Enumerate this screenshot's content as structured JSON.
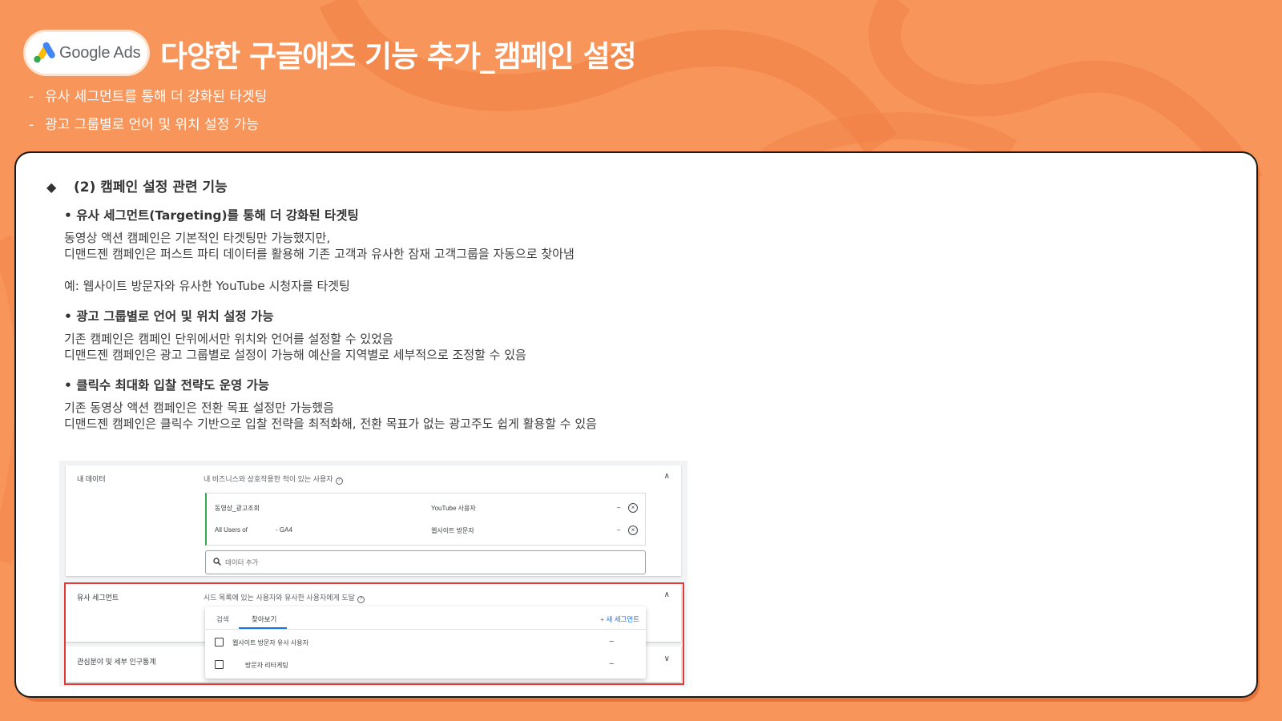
{
  "header": {
    "logo_text": "Google Ads",
    "title": "다양한 구글애즈 기능 추가_캠페인 설정",
    "bullets": [
      "유사 세그먼트를 통해 더 강화된 타겟팅",
      "광고 그룹별로 언어 및 위치 설정 가능"
    ]
  },
  "section": {
    "heading": "(2) 캠페인 설정 관련 기능",
    "features": [
      {
        "title": "• 유사 세그먼트(Targeting)를 통해 더 강화된 타겟팅",
        "lines": [
          "동영상 액션 캠페인은 기본적인 타겟팅만 가능했지만,",
          "디맨드젠 캠페인은 퍼스트 파티 데이터를 활용해 기존 고객과 유사한 잠재 고객그룹을 자동으로 찾아냄"
        ],
        "example": "예: 웹사이트 방문자와 유사한 YouTube 시청자를 타겟팅"
      },
      {
        "title": "• 광고 그룹별로 언어 및 위치 설정 가능",
        "lines": [
          "기존 캠페인은 캠페인 단위에서만 위치와 언어를 설정할 수 있었음",
          "디맨드젠 캠페인은 광고 그룹별로 설정이 가능해 예산을 지역별로 세부적으로 조정할 수 있음"
        ]
      },
      {
        "title": "• 클릭수 최대화 입찰 전략도 운영 가능",
        "lines": [
          "기존 동영상 액션 캠페인은 전환 목표 설정만 가능했음",
          "디맨드젠 캠페인은 클릭수 기반으로 입찰 전략을 최적화해, 전환 목표가 없는 광고주도 쉽게 활용할 수 있음"
        ]
      }
    ]
  },
  "ads_ui": {
    "my_data": {
      "label": "내 데이터",
      "description": "내 비즈니스와 상호작용한 적이 있는 사용자",
      "help_icon": "?",
      "collapse_icon": "∧",
      "rows": [
        {
          "name": "동영상_광고조회",
          "suffix": "",
          "type": "YouTube 사용자",
          "dash": "–",
          "remove": "×"
        },
        {
          "name": "All Users of",
          "suffix": "- GA4",
          "type": "웹사이트 방문자",
          "dash": "–",
          "remove": "×"
        }
      ],
      "search_placeholder": "데이터 추가"
    },
    "similar_segments": {
      "label": "유사 세그먼트",
      "description": "시드 목록에 있는 사용자와 유사한 사용자에게 도달",
      "help_icon": "?",
      "collapse_icon": "∧",
      "tabs": [
        "검색",
        "찾아보기"
      ],
      "new_segment": "+ 새 세그먼트",
      "items": [
        {
          "label": "웹사이트 방문자 유사 사용자",
          "dash": "–"
        },
        {
          "label": "방문자 리타게팅",
          "dash": "–"
        }
      ]
    },
    "interests": {
      "label": "관심분야 및 세부 인구통계",
      "expand_icon": "∨"
    }
  },
  "colors": {
    "background": "#f8955a",
    "card_shadow": "#e8743c",
    "highlight_frame": "#e53935",
    "link": "#1a73e8"
  }
}
